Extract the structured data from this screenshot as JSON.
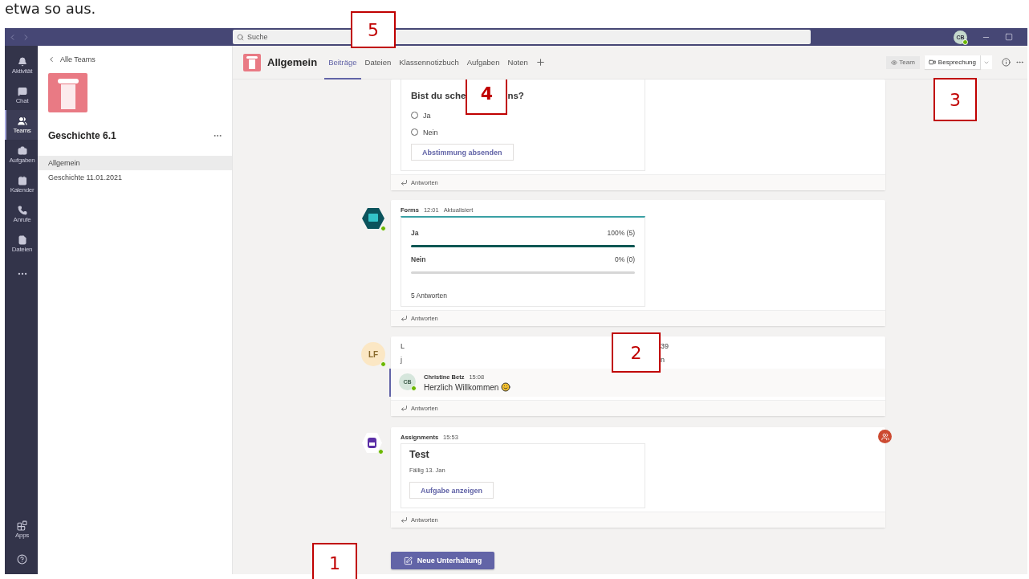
{
  "caption": "etwa so aus.",
  "titlebar": {
    "search_placeholder": "Suche",
    "user_initials": "CB"
  },
  "rail": [
    {
      "label": "Aktivität",
      "selected": false
    },
    {
      "label": "Chat",
      "selected": false
    },
    {
      "label": "Teams",
      "selected": true
    },
    {
      "label": "Aufgaben",
      "selected": false
    },
    {
      "label": "Kalender",
      "selected": false
    },
    {
      "label": "Anrufe",
      "selected": false
    },
    {
      "label": "Dateien",
      "selected": false
    }
  ],
  "rail_bottom": {
    "apps": "Apps"
  },
  "team_panel": {
    "back": "Alle Teams",
    "name": "Geschichte 6.1",
    "channels": [
      {
        "name": "Allgemein",
        "selected": true
      },
      {
        "name": "Geschichte 11.01.2021",
        "selected": false
      }
    ]
  },
  "channel": {
    "name": "Allgemein",
    "tabs": [
      {
        "label": "Beiträge",
        "selected": true
      },
      {
        "label": "Dateien",
        "selected": false
      },
      {
        "label": "Klassennotizbuch",
        "selected": false
      },
      {
        "label": "Aufgaben",
        "selected": false
      },
      {
        "label": "Noten",
        "selected": false
      }
    ],
    "team_button": "Team",
    "meeting_button": "Besprechung"
  },
  "posts": [
    {
      "kind": "poll",
      "question_start": "Bist du sche",
      "question_end": "ns?",
      "options": [
        {
          "label": "Ja",
          "selected": false
        },
        {
          "label": "Nein",
          "selected": false
        }
      ],
      "submit": "Abstimmung absenden",
      "reply": "Antworten"
    },
    {
      "kind": "results",
      "author": "Forms",
      "time": "12:01",
      "note": "Aktualisiert",
      "results": [
        {
          "label": "Ja",
          "reading": "100% (5)",
          "level": 1
        },
        {
          "label": "Nein",
          "reading": "0% (0)",
          "level": 0
        }
      ],
      "total": "5 Antworten",
      "reply": "Antworten"
    },
    {
      "kind": "message",
      "avatar": "LF",
      "author": "L",
      "time": "39",
      "body_start": "j",
      "body_end": "n",
      "replies": [
        {
          "initials": "CB",
          "author": "Christine Betz",
          "time": "15:08",
          "text": "Herzlich Willkommen"
        }
      ],
      "reply": "Antworten"
    },
    {
      "kind": "assignment",
      "author": "Assignments",
      "time": "15:53",
      "title": "Test",
      "due": "Fällig 13. Jan",
      "action": "Aufgabe anzeigen",
      "reply": "Antworten"
    }
  ],
  "new_conversation": "Neue Unterhaltung",
  "callouts": [
    {
      "label": "5"
    },
    {
      "label": "4"
    },
    {
      "label": "3"
    },
    {
      "label": "2"
    },
    {
      "label": "1"
    }
  ]
}
